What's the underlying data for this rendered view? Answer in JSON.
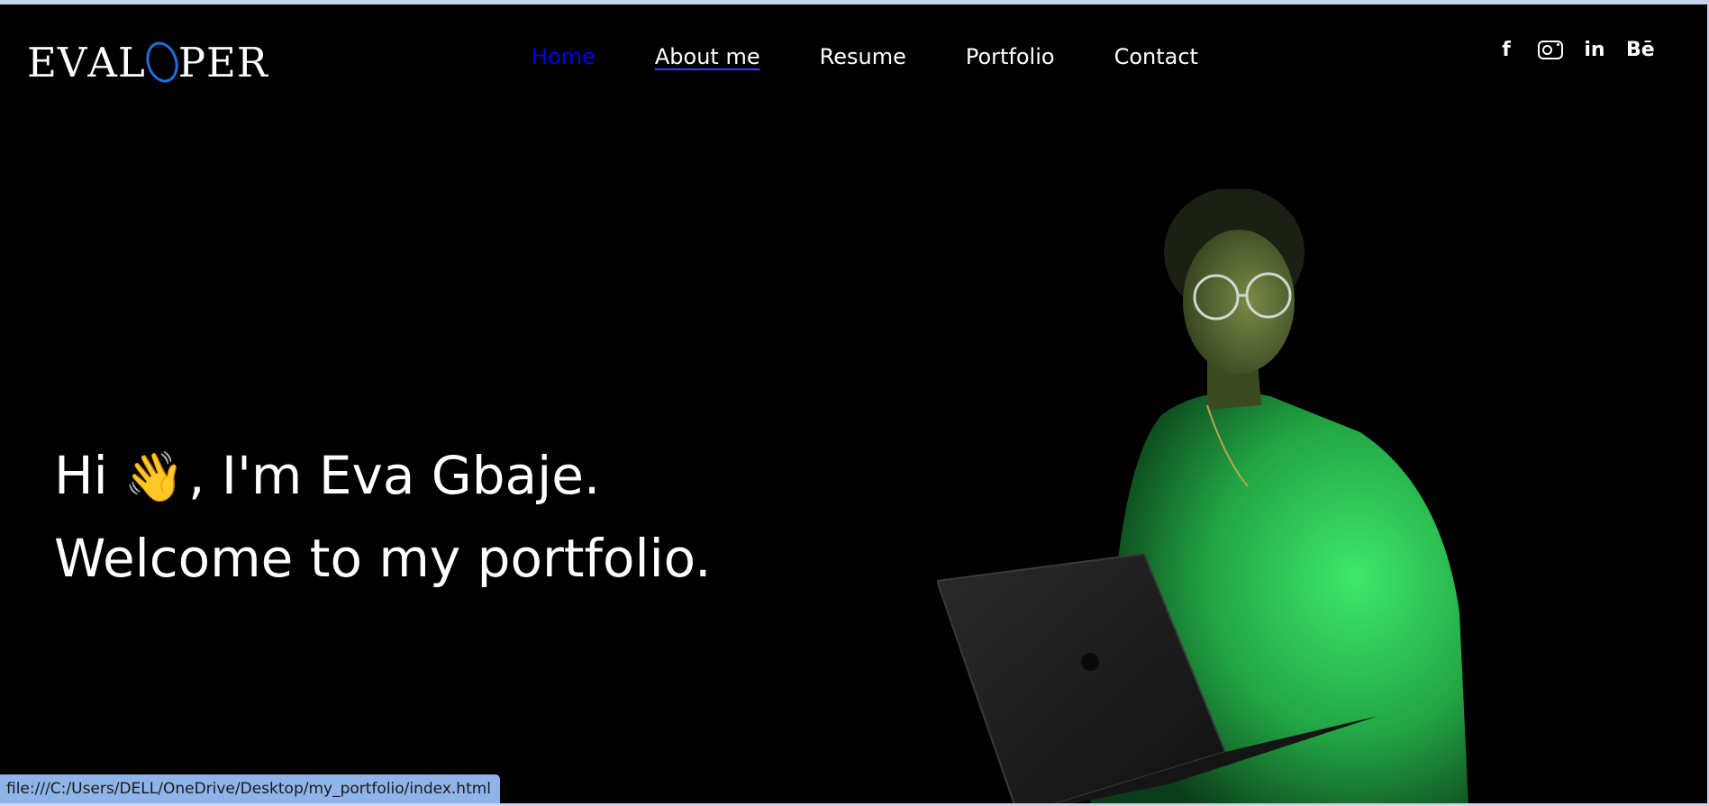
{
  "logo": {
    "left": "E",
    "sub": "V",
    "mid": "AL",
    "right": "PER"
  },
  "nav": {
    "items": [
      {
        "label": "Home"
      },
      {
        "label": "About me"
      },
      {
        "label": "Resume"
      },
      {
        "label": "Portfolio"
      },
      {
        "label": "Contact"
      }
    ],
    "active_color": "#0000ee",
    "text_color": "#ffffff"
  },
  "social": {
    "facebook": "f",
    "instagram_icon": "instagram-icon",
    "linkedin": "in",
    "behance": "Bē"
  },
  "hero": {
    "line1_before": "Hi",
    "wave_emoji": "👋",
    "line1_after": ", I'm Eva Gbaje.",
    "line2": "Welcome to my portfolio."
  },
  "accent_colors": {
    "sweater": "#2fd45a",
    "ring": "#1e6fe0"
  },
  "status_bar": {
    "url": "file:///C:/Users/DELL/OneDrive/Desktop/my_portfolio/index.html"
  }
}
